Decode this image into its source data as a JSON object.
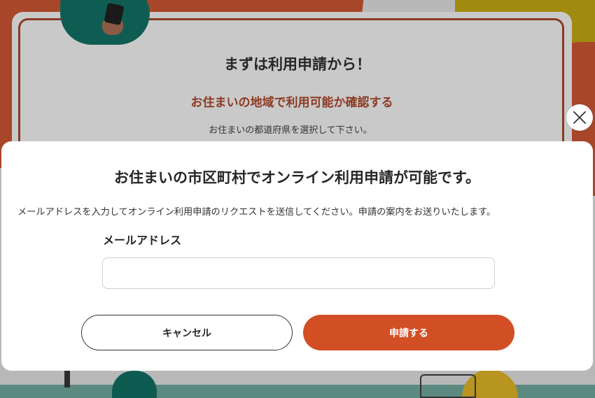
{
  "background": {
    "title": "まずは利用申請から！",
    "subtitle": "お住まいの地域で利用可能か確認する",
    "instruction": "お住まいの都道府県を選択して下さい。"
  },
  "modal": {
    "title": "お住まいの市区町村でオンライン利用申請が可能です。",
    "description": "メールアドレスを入力してオンライン利用申請のリクエストを送信してください。申請の案内をお送りいたします。",
    "email_label": "メールアドレス",
    "email_value": "",
    "email_placeholder": "",
    "cancel_label": "キャンセル",
    "submit_label": "申請する",
    "close_icon": "close-icon"
  },
  "colors": {
    "accent": "#d24e25",
    "heading": "#262626",
    "subtitle": "#8c3a22"
  }
}
